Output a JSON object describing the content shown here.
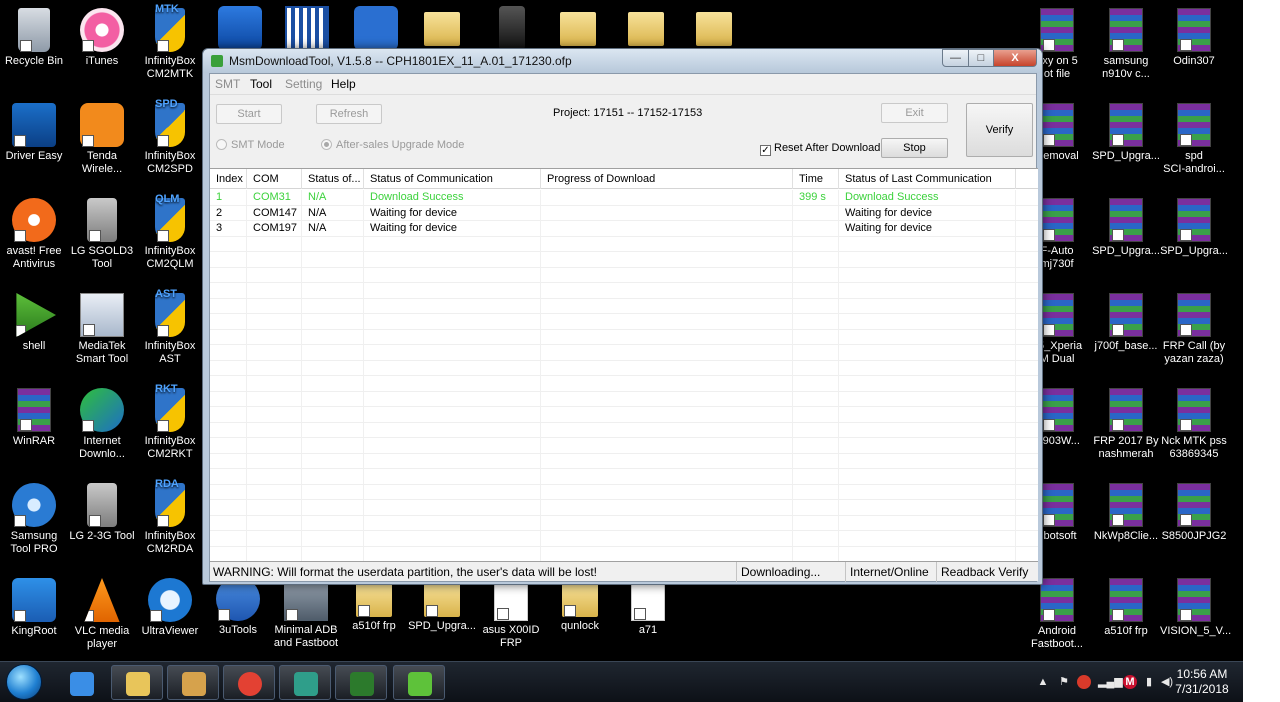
{
  "desktop": {
    "icons_left": [
      {
        "label": "Recycle Bin",
        "icon": "recycle-bin-icon"
      },
      {
        "label": "iTunes",
        "icon": "itunes-icon"
      },
      {
        "label": "InfinityBox\nCM2MTK",
        "icon": "infinitybox-icon",
        "tag": "MTK"
      },
      {
        "label": "Driver Easy",
        "icon": "driver-easy-icon"
      },
      {
        "label": "Tenda\nWirele...",
        "icon": "tenda-icon"
      },
      {
        "label": "InfinityBox\nCM2SPD",
        "icon": "infinitybox-icon",
        "tag": "SPD"
      },
      {
        "label": "avast! Free\nAntivirus",
        "icon": "avast-icon"
      },
      {
        "label": "LG SGOLD3\nTool",
        "icon": "lg-tool-icon"
      },
      {
        "label": "InfinityBox\nCM2QLM",
        "icon": "infinitybox-icon",
        "tag": "QLM"
      },
      {
        "label": "shell",
        "icon": "shell-icon"
      },
      {
        "label": "MediaTek\nSmart Tool",
        "icon": "mediatek-icon"
      },
      {
        "label": "InfinityBox\nAST",
        "icon": "infinitybox-icon",
        "tag": "AST"
      },
      {
        "label": "WinRAR",
        "icon": "winrar-icon"
      },
      {
        "label": "Internet\nDownlo...",
        "icon": "idm-icon"
      },
      {
        "label": "InfinityBox\nCM2RKT",
        "icon": "infinitybox-icon",
        "tag": "RKT"
      },
      {
        "label": "Samsung\nTool PRO",
        "icon": "samsung-tool-icon"
      },
      {
        "label": "LG 2-3G Tool",
        "icon": "lg-tool-icon"
      },
      {
        "label": "InfinityBox\nCM2RDA",
        "icon": "infinitybox-icon",
        "tag": "RDA"
      },
      {
        "label": "KingRoot",
        "icon": "kingroot-icon"
      },
      {
        "label": "VLC media\nplayer",
        "icon": "vlc-icon"
      },
      {
        "label": "UltraViewer",
        "icon": "ultraviewer-icon"
      }
    ],
    "icons_bottom": [
      {
        "label": "3uTools",
        "icon": "3utools-icon"
      },
      {
        "label": "Minimal ADB\nand Fastboot",
        "icon": "adb-icon"
      },
      {
        "label": "a510f frp",
        "icon": "folder-icon"
      },
      {
        "label": "SPD_Upgra...",
        "icon": "folder-icon"
      },
      {
        "label": "asus X00ID\nFRP",
        "icon": "doc-icon"
      },
      {
        "label": "qunlock",
        "icon": "folder-icon"
      },
      {
        "label": "a71",
        "icon": "doc-icon"
      }
    ],
    "icons_right": [
      {
        "label": "axy on 5\not file",
        "icon": "winrar-icon"
      },
      {
        "label": "samsung\nn910v c...",
        "icon": "winrar-icon"
      },
      {
        "label": "Odin307",
        "icon": "winrar-icon"
      },
      {
        "label": "Removal",
        "icon": "winrar-icon"
      },
      {
        "label": "SPD_Upgra...",
        "icon": "winrar-icon"
      },
      {
        "label": "spd\nSCI-androi...",
        "icon": "winrar-icon"
      },
      {
        "label": "F-Auto\nmj730f",
        "icon": "winrar-icon"
      },
      {
        "label": "SPD_Upgra...",
        "icon": "winrar-icon"
      },
      {
        "label": "SPD_Upgra...",
        "icon": "winrar-icon"
      },
      {
        "label": "05_Xperia\nM Dual",
        "icon": "winrar-icon"
      },
      {
        "label": "j700f_base...",
        "icon": "winrar-icon"
      },
      {
        "label": "FRP Call (by\nyazan zaza)",
        "icon": "winrar-icon"
      },
      {
        "label": "G903W...",
        "icon": "winrar-icon"
      },
      {
        "label": "FRP 2017 By\nnashmerah",
        "icon": "winrar-icon"
      },
      {
        "label": "Nck MTK pss\n63869345",
        "icon": "winrar-icon"
      },
      {
        "label": "obotsoft",
        "icon": "winrar-icon"
      },
      {
        "label": "NkWp8Clie...",
        "icon": "winrar-icon"
      },
      {
        "label": "S8500JPJG2",
        "icon": "winrar-icon"
      },
      {
        "label": "Android\nFastboot...",
        "icon": "winrar-icon"
      },
      {
        "label": "a510f frp",
        "icon": "winrar-icon"
      },
      {
        "label": "VISION_5_V...",
        "icon": "winrar-icon"
      }
    ]
  },
  "window": {
    "title": "MsmDownloadTool, V1.5.8 -- CPH1801EX_11_A.01_171230.ofp",
    "min_glyph": "—",
    "max_glyph": "□",
    "close_glyph": "X",
    "menu": [
      "SMT",
      "Tool",
      "Setting",
      "Help"
    ],
    "buttons": {
      "start": "Start",
      "refresh": "Refresh",
      "exit": "Exit",
      "stop": "Stop",
      "verify": "Verify"
    },
    "project": "Project: 17151 -- 17152-17153",
    "smt_mode": "SMT Mode",
    "after_sales": "After-sales Upgrade Mode",
    "reset_after_download": "Reset After Download",
    "reset_checked": "✓",
    "table": {
      "columns": [
        "Index",
        "COM",
        "Status of...",
        "Status of Communication",
        "Progress of Download",
        "Time",
        "Status of Last Communication"
      ],
      "rows": [
        {
          "index": "1",
          "com": "COM31",
          "status": "N/A",
          "comm": "Download Success",
          "progress": "",
          "time": "399 s",
          "last": "Download Success",
          "ok": true
        },
        {
          "index": "2",
          "com": "COM147",
          "status": "N/A",
          "comm": "Waiting for device",
          "progress": "",
          "time": "",
          "last": "Waiting for device",
          "ok": false
        },
        {
          "index": "3",
          "com": "COM197",
          "status": "N/A",
          "comm": "Waiting for device",
          "progress": "",
          "time": "",
          "last": "Waiting for device",
          "ok": false
        }
      ]
    },
    "statusbar": {
      "warning": "WARNING: Will format the userdata partition, the user's data will be lost!",
      "state": "Downloading...",
      "network": "Internet/Online",
      "readback": "Readback Verify"
    }
  },
  "taskbar": {
    "items": [
      "internet-explorer-icon",
      "explorer-icon",
      "media-player-icon",
      "chrome-icon",
      "ccleaner-icon",
      "grenade-icon",
      "msm-download-icon"
    ],
    "tray_arrow": "▲",
    "time": "10:56 AM",
    "date": "7/31/2018"
  },
  "colors": {
    "success": "#3cd23c",
    "desktop_bg": "#000000",
    "window_frame": "#b9c9db"
  }
}
